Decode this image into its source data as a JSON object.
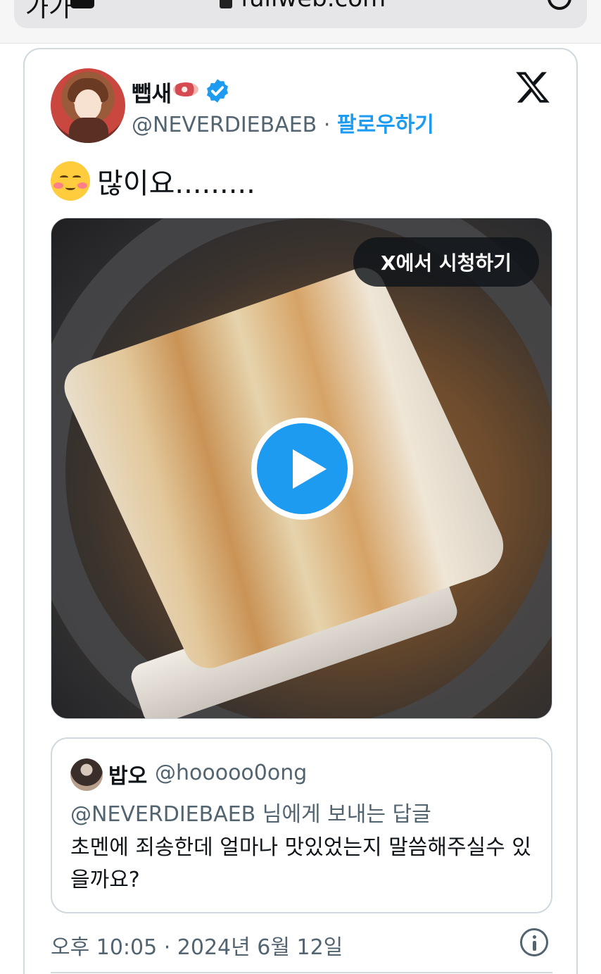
{
  "browser": {
    "aa_label": "가가",
    "url": "fullweb.com"
  },
  "tweet": {
    "display_name": "뺍새",
    "handle": "@NEVERDIEBAEB",
    "separator": "·",
    "follow_label": "팔로우하기",
    "text": "많이요.........",
    "watch_on_x_label": "X에서 시청하기",
    "timestamp": "오후 10:05 · 2024년 6월 12일"
  },
  "quoted": {
    "name": "밥오",
    "handle": "@hooooo0ong",
    "reply_context": "@NEVERDIEBAEB 님에게 보내는 답글",
    "text": "초멘에 죄송한데 얼마나 맛있었는지 말씀해주실수 있을까요?"
  },
  "colors": {
    "link": "#1d9bf0",
    "secondary_text": "#536471",
    "border": "#cfd9de"
  }
}
